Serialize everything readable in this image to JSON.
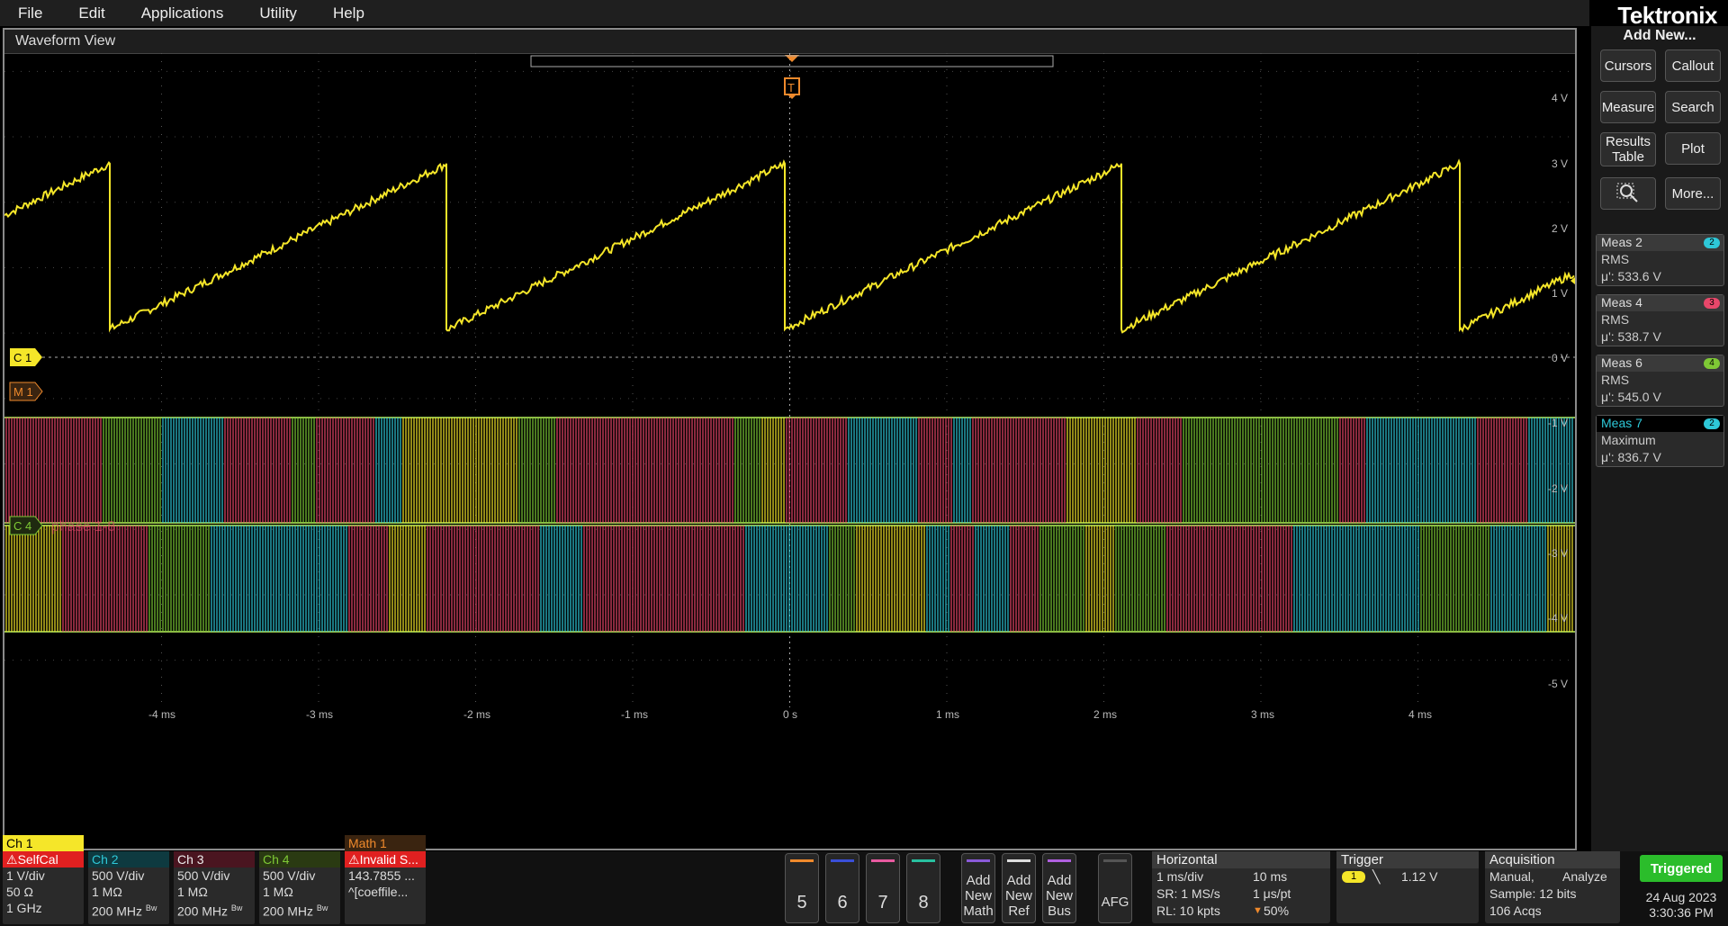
{
  "menu": [
    "File",
    "Edit",
    "Applications",
    "Utility",
    "Help"
  ],
  "brand": "Tektronix",
  "waveform_view": {
    "title": "Waveform View",
    "trigger_marker": "T",
    "volt_labels": [
      "4 V",
      "3 V",
      "2 V",
      "1 V",
      "0 V",
      "-1 V",
      "-2 V",
      "-3 V",
      "-4 V",
      "-5 V"
    ],
    "time_labels": [
      "-4 ms",
      "-3 ms",
      "-2 ms",
      "-1 ms",
      "0 s",
      "1 ms",
      "2 ms",
      "3 ms",
      "4 ms"
    ],
    "markers": {
      "c1": "C 1",
      "m1": "M 1",
      "c4": "C 4"
    },
    "bus_label": "phase 1-8"
  },
  "right_panel": {
    "add_new": "Add New...",
    "buttons": [
      "Cursors",
      "Callout",
      "Measure",
      "Search",
      "Results Table",
      "Plot",
      "",
      "More..."
    ],
    "measurements": [
      {
        "title": "Meas 2",
        "type": "RMS",
        "value": "μ': 533.6 V",
        "badge": "2",
        "color": "#2ec8d8"
      },
      {
        "title": "Meas 4",
        "type": "RMS",
        "value": "μ': 538.7 V",
        "badge": "3",
        "color": "#e8476a"
      },
      {
        "title": "Meas 6",
        "type": "RMS",
        "value": "μ': 545.0 V",
        "badge": "4",
        "color": "#7ec935"
      },
      {
        "title": "Meas 7",
        "type": "Maximum",
        "value": "μ': 836.7 V",
        "badge": "2",
        "color": "#2ec8d8"
      }
    ]
  },
  "channels": [
    {
      "name": "Ch 1",
      "l1": "SelfCal",
      "l2": "1 V/div",
      "l3": "50 Ω",
      "l4": "1 GHz",
      "color": "#f5e629",
      "warn": true
    },
    {
      "name": "Ch 2",
      "l2": "500 V/div",
      "l3": "1 MΩ",
      "l4": "200 MHz",
      "bw": "Bw",
      "color": "#2ec8d8"
    },
    {
      "name": "Ch 3",
      "l2": "500 V/div",
      "l3": "1 MΩ",
      "l4": "200 MHz",
      "bw": "Bw",
      "color": "#e8476a"
    },
    {
      "name": "Ch 4",
      "l2": "500 V/div",
      "l3": "1 MΩ",
      "l4": "200 MHz",
      "bw": "Bw",
      "color": "#7ec935"
    },
    {
      "name": "Math 1",
      "l1": "Invalid S...",
      "l2": "143.7855 ...",
      "l3": "^[coeffile...",
      "color": "#f08a2c",
      "warn": true
    }
  ],
  "slots": [
    "5",
    "6",
    "7",
    "8"
  ],
  "add_buttons": [
    "Add New Math",
    "Add New Ref",
    "Add New Bus"
  ],
  "afg": "AFG",
  "horizontal": {
    "title": "Horizontal",
    "scale": "1 ms/div",
    "duration": "10 ms",
    "sr": "SR: 1 MS/s",
    "pt": "1 μs/pt",
    "rl": "RL: 10 kpts",
    "pos": "50%"
  },
  "trigger": {
    "title": "Trigger",
    "source": "1",
    "level": "1.12 V"
  },
  "acquisition": {
    "title": "Acquisition",
    "mode": "Manual,",
    "analyze": "Analyze",
    "sample": "Sample: 12 bits",
    "acqs": "106 Acqs"
  },
  "status": {
    "triggered": "Triggered",
    "date": "24 Aug 2023",
    "time": "3:30:36 PM"
  }
}
